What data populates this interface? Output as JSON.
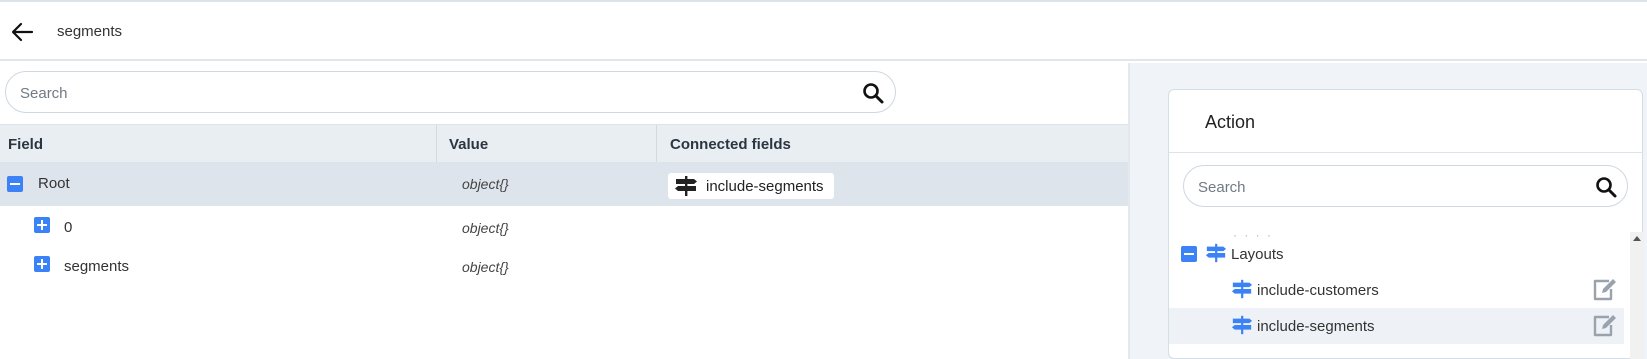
{
  "header": {
    "title": "segments",
    "back_icon": "arrow-left-icon"
  },
  "left": {
    "search": {
      "placeholder": "Search",
      "value": ""
    },
    "table": {
      "columns": [
        "Field",
        "Value",
        "Connected fields"
      ],
      "rows": [
        {
          "field": "Root",
          "value": "object{}",
          "expanded": true,
          "selected": true,
          "connected": "include-segments"
        },
        {
          "field": "0",
          "value": "object{}",
          "expanded": false,
          "selected": false,
          "connected": ""
        },
        {
          "field": "segments",
          "value": "object{}",
          "expanded": false,
          "selected": false,
          "connected": ""
        }
      ]
    }
  },
  "action": {
    "title": "Action",
    "search": {
      "placeholder": "Search",
      "value": ""
    },
    "faded_row": "· · · ·",
    "tree": {
      "group": {
        "label": "Layouts",
        "expanded": true,
        "icon": "signpost-icon"
      },
      "items": [
        {
          "label": "include-customers",
          "icon": "signpost-icon",
          "highlighted": false
        },
        {
          "label": "include-segments",
          "icon": "signpost-icon",
          "highlighted": true
        }
      ]
    }
  },
  "colors": {
    "accent": "#3b82f6",
    "header_border": "#dfe6ee",
    "table_header_bg": "#e9eef3",
    "selected_row_bg": "#dde4ec",
    "right_panel_bg": "#f0f3f7",
    "edit_icon": "#9aa3ad"
  }
}
